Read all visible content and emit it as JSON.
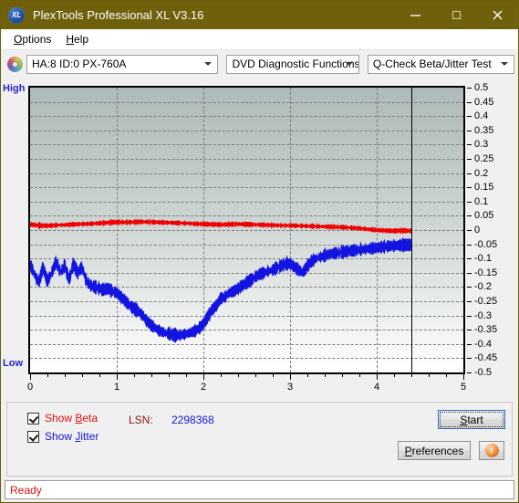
{
  "window": {
    "title": "PlexTools Professional XL V3.16",
    "app_icon": "xl-logo-icon",
    "minimize_label": "–",
    "maximize_label": "□",
    "close_label": "✕"
  },
  "menubar": {
    "items": [
      {
        "label": "Options",
        "accel": "O"
      },
      {
        "label": "Help",
        "accel": "H"
      }
    ]
  },
  "toolbar": {
    "drive_icon": "optical-disc-icon",
    "drive_select": "HA:8 ID:0  PX-760A",
    "function_select": "DVD Diagnostic Functions",
    "test_select": "Q-Check Beta/Jitter Test"
  },
  "chart_labels": {
    "high": "High",
    "low": "Low"
  },
  "controls": {
    "show_beta": {
      "label": "Show Beta",
      "checked": true,
      "color": "#e01010"
    },
    "show_jitter": {
      "label": "Show Jitter",
      "checked": true,
      "color": "#1616d8"
    },
    "lsn_label": "LSN:",
    "lsn_value": "2298368",
    "start_label": "Start",
    "preferences_label": "Preferences",
    "info_label": "i",
    "info_icon": "info-icon"
  },
  "statusbar": {
    "text": "Ready"
  },
  "chart_data": {
    "type": "line",
    "title": "Q-Check Beta/Jitter Test",
    "xlabel": "",
    "ylabel": "",
    "xlim": [
      0,
      5
    ],
    "ylim": [
      -0.5,
      0.5
    ],
    "xticks": [
      0,
      1,
      2,
      3,
      4,
      5
    ],
    "xtick_labels": [
      "0",
      "1",
      "2",
      "3",
      "4",
      "5"
    ],
    "yticks": [
      0.5,
      0.45,
      0.4,
      0.35,
      0.3,
      0.25,
      0.2,
      0.15,
      0.1,
      0.05,
      0,
      -0.05,
      -0.1,
      -0.15,
      -0.2,
      -0.25,
      -0.3,
      -0.35,
      -0.4,
      -0.45,
      -0.5
    ],
    "ytick_labels": [
      "0.5",
      "0.45",
      "0.4",
      "0.35",
      "0.3",
      "0.25",
      "0.2",
      "0.15",
      "0.1",
      "0.05",
      "0",
      "-0.05",
      "-0.1",
      "-0.15",
      "-0.2",
      "-0.25",
      "-0.3",
      "-0.35",
      "-0.4",
      "-0.45",
      "-0.5"
    ],
    "grid": true,
    "grid_style": "dashed",
    "axis_left_label": "High",
    "axis_left_bottom_label": "Low",
    "cursor_x": 4.4,
    "cursor_color": "#000000",
    "legend": [
      "Show Beta",
      "Show Jitter"
    ],
    "legend_position": "below-plot",
    "series": [
      {
        "name": "Beta",
        "color": "#ee0000",
        "x": [
          0.0,
          0.1,
          0.2,
          0.3,
          0.4,
          0.5,
          0.6,
          0.7,
          0.8,
          0.9,
          1.0,
          1.1,
          1.2,
          1.3,
          1.4,
          1.5,
          1.6,
          1.7,
          1.8,
          1.9,
          2.0,
          2.1,
          2.2,
          2.3,
          2.4,
          2.5,
          2.6,
          2.7,
          2.8,
          2.9,
          3.0,
          3.1,
          3.2,
          3.3,
          3.4,
          3.5,
          3.6,
          3.7,
          3.8,
          3.9,
          4.0,
          4.1,
          4.2,
          4.3,
          4.4
        ],
        "y": [
          0.02,
          0.016,
          0.015,
          0.017,
          0.018,
          0.02,
          0.021,
          0.022,
          0.024,
          0.026,
          0.028,
          0.027,
          0.028,
          0.029,
          0.028,
          0.027,
          0.026,
          0.025,
          0.024,
          0.022,
          0.021,
          0.02,
          0.019,
          0.02,
          0.021,
          0.02,
          0.019,
          0.018,
          0.017,
          0.016,
          0.016,
          0.015,
          0.014,
          0.013,
          0.012,
          0.011,
          0.01,
          0.008,
          0.006,
          0.003,
          0.0,
          -0.002,
          -0.003,
          -0.002,
          -0.003
        ],
        "noise": 0.007
      },
      {
        "name": "Jitter",
        "color": "#1414e0",
        "x": [
          0.0,
          0.05,
          0.1,
          0.15,
          0.2,
          0.25,
          0.3,
          0.35,
          0.4,
          0.45,
          0.5,
          0.55,
          0.6,
          0.65,
          0.7,
          0.75,
          0.8,
          0.85,
          0.9,
          0.95,
          1.0,
          1.05,
          1.1,
          1.15,
          1.2,
          1.25,
          1.3,
          1.35,
          1.4,
          1.45,
          1.5,
          1.55,
          1.6,
          1.65,
          1.7,
          1.75,
          1.8,
          1.85,
          1.9,
          1.95,
          2.0,
          2.05,
          2.1,
          2.15,
          2.2,
          2.25,
          2.3,
          2.35,
          2.4,
          2.45,
          2.5,
          2.55,
          2.6,
          2.65,
          2.7,
          2.75,
          2.8,
          2.85,
          2.9,
          2.95,
          3.0,
          3.05,
          3.1,
          3.15,
          3.2,
          3.25,
          3.3,
          3.35,
          3.4,
          3.45,
          3.5,
          3.55,
          3.6,
          3.65,
          3.7,
          3.75,
          3.8,
          3.85,
          3.9,
          3.95,
          4.0,
          4.05,
          4.1,
          4.15,
          4.2,
          4.25,
          4.3,
          4.35,
          4.4
        ],
        "y": [
          -0.12,
          -0.155,
          -0.185,
          -0.13,
          -0.18,
          -0.15,
          -0.11,
          -0.15,
          -0.125,
          -0.175,
          -0.12,
          -0.15,
          -0.13,
          -0.18,
          -0.195,
          -0.2,
          -0.205,
          -0.21,
          -0.205,
          -0.215,
          -0.22,
          -0.235,
          -0.25,
          -0.265,
          -0.275,
          -0.285,
          -0.3,
          -0.32,
          -0.335,
          -0.345,
          -0.355,
          -0.36,
          -0.365,
          -0.368,
          -0.37,
          -0.368,
          -0.365,
          -0.36,
          -0.355,
          -0.345,
          -0.33,
          -0.305,
          -0.28,
          -0.265,
          -0.24,
          -0.235,
          -0.22,
          -0.215,
          -0.205,
          -0.195,
          -0.185,
          -0.175,
          -0.165,
          -0.155,
          -0.15,
          -0.145,
          -0.14,
          -0.132,
          -0.125,
          -0.12,
          -0.118,
          -0.13,
          -0.14,
          -0.15,
          -0.125,
          -0.11,
          -0.1,
          -0.095,
          -0.09,
          -0.085,
          -0.082,
          -0.08,
          -0.078,
          -0.075,
          -0.073,
          -0.071,
          -0.07,
          -0.068,
          -0.066,
          -0.064,
          -0.062,
          -0.06,
          -0.058,
          -0.056,
          -0.055,
          -0.054,
          -0.053,
          -0.052,
          -0.052
        ],
        "noise": 0.022
      }
    ]
  }
}
